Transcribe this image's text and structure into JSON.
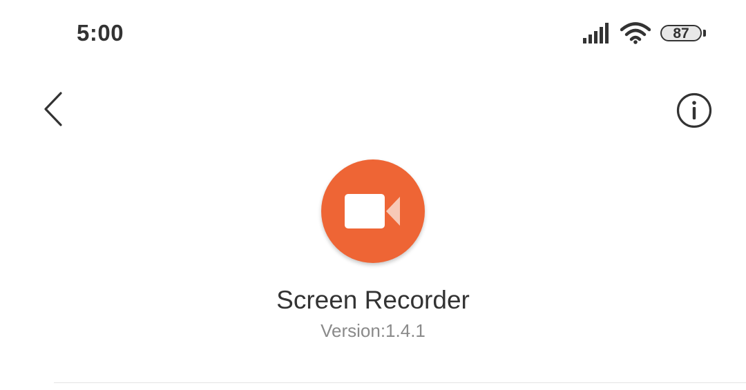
{
  "status_bar": {
    "time": "5:00",
    "signal_icon": "cellular-signal-icon",
    "wifi_icon": "wifi-icon",
    "battery_level": "87"
  },
  "toolbar": {
    "back_icon": "chevron-left-icon",
    "info_icon": "info-icon"
  },
  "app": {
    "icon": "video-camera-icon",
    "icon_color": "#ee6535",
    "name": "Screen Recorder",
    "version": "Version:1.4.1"
  }
}
